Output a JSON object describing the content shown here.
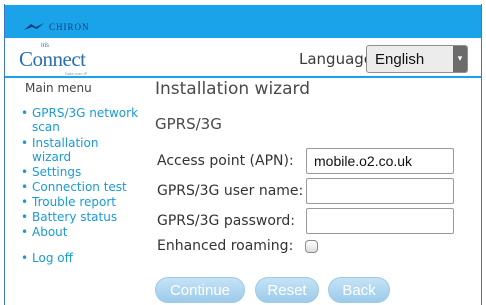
{
  "header": {
    "brand": "CHIRON",
    "product_small": "Iris",
    "product_name": "Connect",
    "product_tagline": "Data over IP"
  },
  "language": {
    "label": "Language:",
    "selected": "English"
  },
  "menu": {
    "title": "Main menu",
    "items": [
      {
        "label": "GPRS/3G network scan"
      },
      {
        "label": "Installation wizard"
      },
      {
        "label": "Settings"
      },
      {
        "label": "Connection test"
      },
      {
        "label": "Trouble report"
      },
      {
        "label": "Battery status"
      },
      {
        "label": "About"
      },
      {
        "label": "Log off"
      }
    ]
  },
  "main": {
    "title": "Installation wizard",
    "section": "GPRS/3G",
    "fields": {
      "apn_label": "Access point (APN):",
      "apn_value": "mobile.o2.co.uk",
      "user_label": "GPRS/3G user name:",
      "user_value": "",
      "password_label": "GPRS/3G password:",
      "password_value": "",
      "roaming_label": "Enhanced roaming:",
      "roaming_checked": false
    },
    "buttons": {
      "continue": "Continue",
      "reset": "Reset",
      "back": "Back"
    }
  },
  "colors": {
    "accent": "#1aa3e8",
    "link": "#1a9ad6",
    "button": "#a8d2ee"
  }
}
